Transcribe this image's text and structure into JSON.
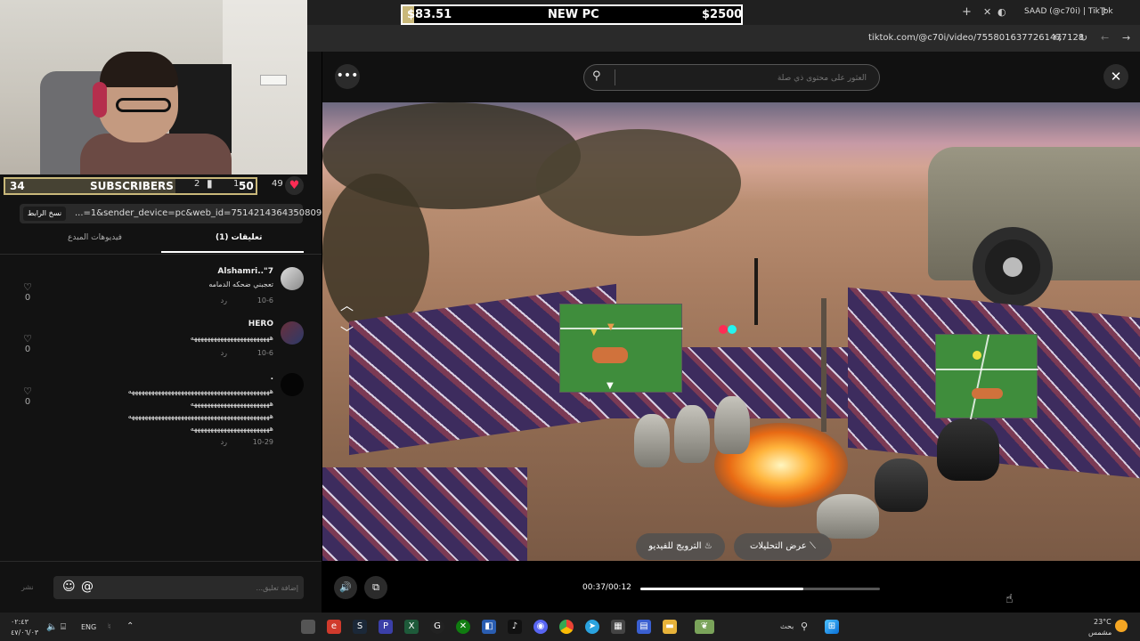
{
  "stream_overlay": {
    "subscribers_label": "SUBSCRIBERS",
    "subscribers_left": "34",
    "subscribers_goal": "50",
    "subscribers_progress": 0.68,
    "goal_current": "$83.51",
    "goal_title": "NEW PC",
    "goal_target": "$2500",
    "goal_progress": 0.033
  },
  "stats": {
    "bookmarks": "2",
    "shares": "1",
    "likes": "49"
  },
  "link": {
    "copy_label": "نسخ الرابط",
    "text": "...=1&sender_device=pc&web_id=7514214364350809608"
  },
  "panel_tabs": {
    "comments": "(1) تعليقات",
    "creator_videos": "فيديوهات المبدع"
  },
  "comments": [
    {
      "name": "Alshamri..\"7",
      "text": "تعجبني ضحكه الدمامه",
      "date": "10-6",
      "reply": "رد",
      "likes": "0"
    },
    {
      "name": "HERO",
      "text": "ههههههههههههههههههههههههه",
      "date": "10-6",
      "reply": "رد",
      "likes": "0"
    },
    {
      "name": ".",
      "lines": [
        "هههههههههههههههههههههههههههههههههههههههههههه",
        "ههههههههههههههههههههههههه",
        "هههههههههههههههههههههههههههههههههههههههههههه",
        "ههههههههههههههههههههههههه"
      ],
      "date": "10-29",
      "reply": "رد",
      "likes": "0"
    }
  ],
  "comment_input": {
    "placeholder": "إضافة تعليق...",
    "post_label": "نشر"
  },
  "browser": {
    "tab_title": "SAAD (@c70i) | TikTok",
    "url": "tiktok.com/@c70i/video/7558016377261477128"
  },
  "search": {
    "placeholder": "العثور على محتوى ذي صلة"
  },
  "video_pills": {
    "promote": "الترويج للفيديو",
    "analytics": "عرض التحليلات"
  },
  "player": {
    "time": "00:37/00:12",
    "progress": 0.68
  },
  "taskbar": {
    "search_label": "بحث",
    "lang": "ENG",
    "time": "٠٢:٤٣",
    "date": "٤٧/٠٦/٠٣",
    "weather_temp": "23°C",
    "weather_desc": "مشمس"
  }
}
